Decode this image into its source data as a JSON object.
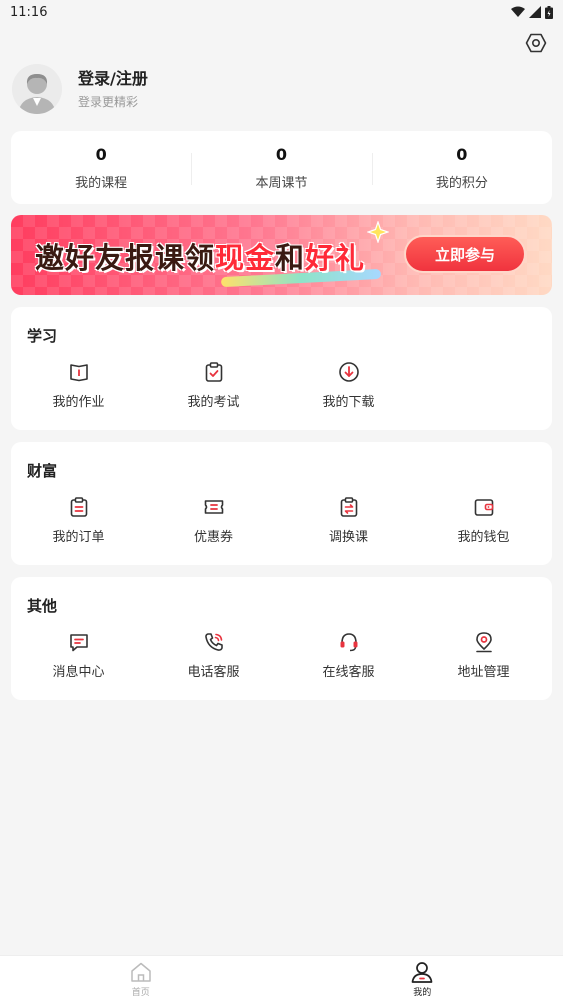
{
  "status_bar": {
    "time": "11:16"
  },
  "profile": {
    "title": "登录/注册",
    "subtitle": "登录更精彩"
  },
  "stats": [
    {
      "value": "0",
      "label": "我的课程"
    },
    {
      "value": "0",
      "label": "本周课节"
    },
    {
      "value": "0",
      "label": "我的积分"
    }
  ],
  "banner": {
    "text_part1": "邀好友报课领",
    "text_highlight1": "现金",
    "text_part2": "和",
    "text_highlight2": "好礼",
    "button": "立即参与",
    "colors": {
      "start": "#ff3d5f",
      "end": "#ffd9c4",
      "highlight": "#ff2a38"
    }
  },
  "sections": [
    {
      "title": "学习",
      "items": [
        {
          "label": "我的作业",
          "icon": "homework-icon"
        },
        {
          "label": "我的考试",
          "icon": "exam-icon"
        },
        {
          "label": "我的下载",
          "icon": "download-icon"
        }
      ]
    },
    {
      "title": "财富",
      "items": [
        {
          "label": "我的订单",
          "icon": "order-icon"
        },
        {
          "label": "优惠券",
          "icon": "coupon-icon"
        },
        {
          "label": "调换课",
          "icon": "swap-course-icon"
        },
        {
          "label": "我的钱包",
          "icon": "wallet-icon"
        }
      ]
    },
    {
      "title": "其他",
      "items": [
        {
          "label": "消息中心",
          "icon": "message-icon"
        },
        {
          "label": "电话客服",
          "icon": "phone-icon"
        },
        {
          "label": "在线客服",
          "icon": "headset-icon"
        },
        {
          "label": "地址管理",
          "icon": "location-icon"
        }
      ]
    }
  ],
  "tabbar": [
    {
      "label": "首页",
      "icon": "home-icon",
      "active": false
    },
    {
      "label": "我的",
      "icon": "profile-icon",
      "active": true
    }
  ],
  "accent_color": "#e8343f"
}
